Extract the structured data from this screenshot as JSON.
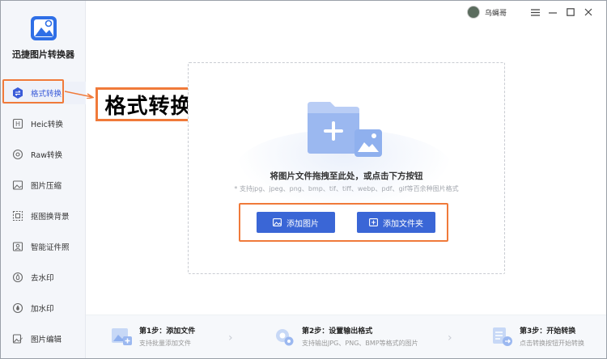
{
  "app": {
    "title": "迅捷图片转换器"
  },
  "user": {
    "name": "乌蝇哥"
  },
  "sidebar": {
    "items": [
      {
        "label": "格式转换",
        "icon": "format-convert-icon",
        "active": true
      },
      {
        "label": "Heic转换",
        "icon": "heic-icon"
      },
      {
        "label": "Raw转换",
        "icon": "raw-icon"
      },
      {
        "label": "图片压缩",
        "icon": "compress-icon"
      },
      {
        "label": "抠图换背景",
        "icon": "cutout-icon"
      },
      {
        "label": "智能证件照",
        "icon": "id-photo-icon"
      },
      {
        "label": "去水印",
        "icon": "remove-watermark-icon"
      },
      {
        "label": "加水印",
        "icon": "add-watermark-icon"
      },
      {
        "label": "图片编辑",
        "icon": "image-edit-icon"
      }
    ]
  },
  "callout": {
    "label": "格式转换"
  },
  "dropzone": {
    "text": "将图片文件拖拽至此处，或点击下方按钮",
    "hint": "* 支持jpg、jpeg、png、bmp、tif、tiff、webp、pdf、gif等百余种图片格式",
    "add_image": "添加图片",
    "add_folder": "添加文件夹"
  },
  "steps": [
    {
      "title": "第1步：添加文件",
      "desc": "支持批量添加文件"
    },
    {
      "title": "第2步：设置输出格式",
      "desc": "支持输出JPG、PNG、BMP等格式的图片"
    },
    {
      "title": "第3步：开始转换",
      "desc": "点击转换按钮开始转换"
    }
  ],
  "colors": {
    "accent": "#3a66d6",
    "highlight": "#f07a3a"
  }
}
